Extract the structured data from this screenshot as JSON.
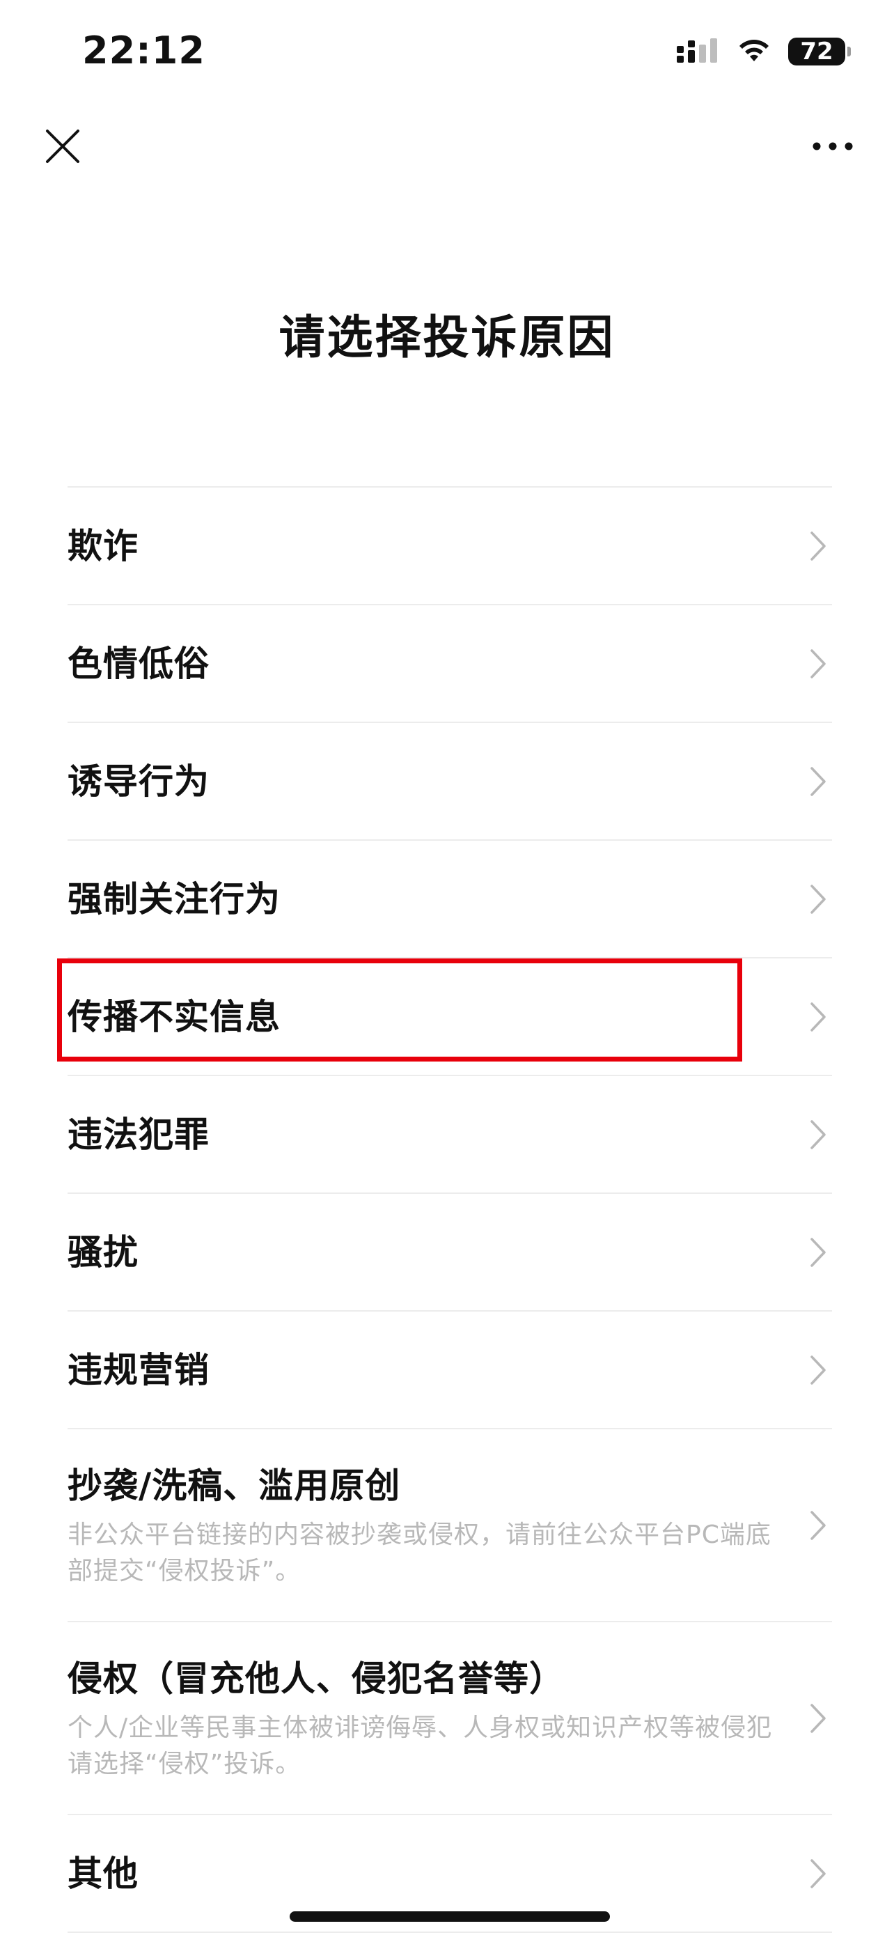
{
  "status_bar": {
    "time": "22:12",
    "battery": "72",
    "icons": [
      "signal-icon",
      "wifi-icon",
      "battery-icon"
    ]
  },
  "nav": {
    "icons": [
      "close-icon",
      "more-icon"
    ]
  },
  "page": {
    "title": "请选择投诉原因"
  },
  "reasons": [
    {
      "label": "欺诈"
    },
    {
      "label": "色情低俗"
    },
    {
      "label": "诱导行为"
    },
    {
      "label": "强制关注行为"
    },
    {
      "label": "传播不实信息",
      "highlighted": true
    },
    {
      "label": "违法犯罪"
    },
    {
      "label": "骚扰"
    },
    {
      "label": "违规营销"
    },
    {
      "label": "抄袭/洗稿、滥用原创",
      "description": "非公众平台链接的内容被抄袭或侵权，请前往公众平台PC端底部提交“侵权投诉”。"
    },
    {
      "label": "侵权（冒充他人、侵犯名誉等）",
      "description": "个人/企业等民事主体被诽谤侮辱、人身权或知识产权等被侵犯请选择“侵权”投诉。"
    },
    {
      "label": "其他"
    }
  ],
  "colors": {
    "highlight": "#e8000b",
    "divider": "#ececec",
    "description": "#b8b8b8",
    "chevron": "#b8b8b8"
  }
}
